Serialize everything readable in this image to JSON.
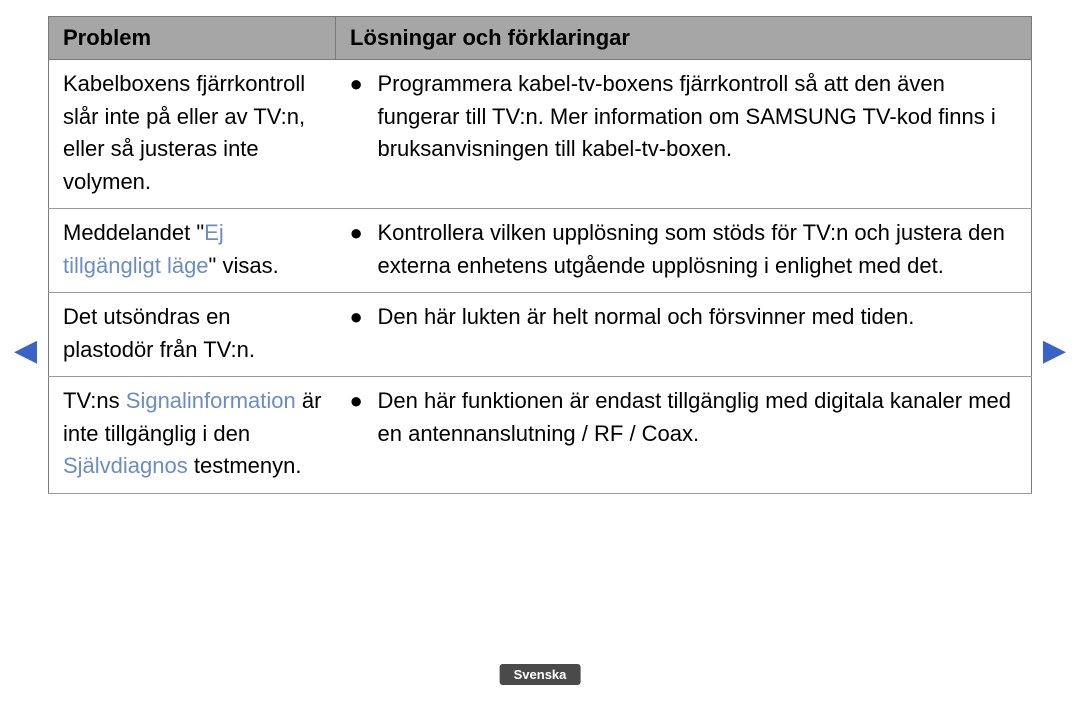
{
  "header": {
    "problem": "Problem",
    "solution": "Lösningar och förklaringar"
  },
  "rows": [
    {
      "problem": {
        "plain": "Kabelboxens fjärrkontroll slår inte på eller av TV:n, eller så justeras inte volymen."
      },
      "solution": "Programmera kabel-tv-boxens fjärrkontroll så att den även fungerar till TV:n. Mer information om SAMSUNG TV-kod finns i bruksanvisningen till kabel-tv-boxen."
    },
    {
      "problem": {
        "pre": "Meddelandet \"",
        "hl": "Ej tillgängligt läge",
        "post": "\" visas."
      },
      "solution": "Kontrollera vilken upplösning som stöds för TV:n och justera den externa enhetens utgående upplösning i enlighet med det."
    },
    {
      "problem": {
        "plain": "Det utsöndras en plastodör från TV:n."
      },
      "solution": "Den här lukten är helt normal och försvinner med tiden."
    },
    {
      "problem": {
        "p1": "TV:ns ",
        "h1": "Signalinformation",
        "p2": " är inte tillgänglig i den ",
        "h2": "Självdiagnos",
        "p3": " testmenyn."
      },
      "solution": "Den här funktionen är endast tillgänglig med digitala kanaler med en antennanslutning / RF / Coax."
    }
  ],
  "nav": {
    "prev_glyph": "▶",
    "next_glyph": "▶"
  },
  "footer": {
    "language": "Svenska"
  }
}
